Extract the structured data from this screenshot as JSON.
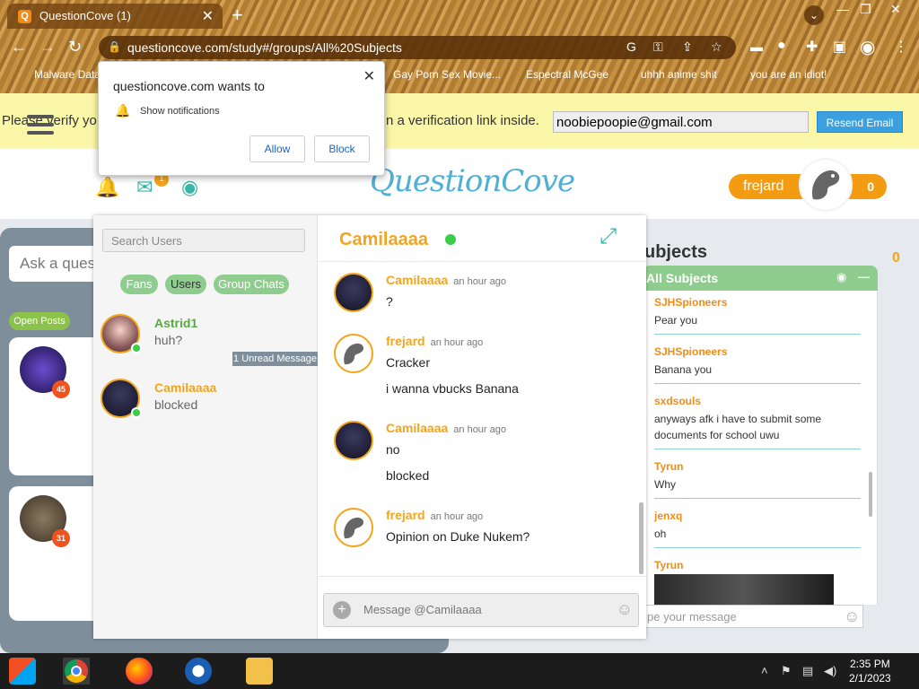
{
  "browser": {
    "tab_title": "QuestionCove (1)",
    "tab_favicon": "Q",
    "url": "questioncove.com/study#/groups/All%20Subjects",
    "bookmarks": [
      "Malware Data",
      "Gay Porn Sex Movie...",
      "Espectral McGee",
      "uhhh anime shit",
      "you are an idiot!"
    ]
  },
  "notification_prompt": {
    "title": "questioncove.com wants to",
    "permission": "Show notifications",
    "allow_label": "Allow",
    "block_label": "Block"
  },
  "verify_bar": {
    "text_start": "Please verify yo",
    "text_end": "n a verification link inside.",
    "email_value": "noobiepoopie@gmail.com",
    "resend_label": "Resend Email"
  },
  "header": {
    "logo_text": "QuestionCove",
    "mail_badge": "1",
    "username": "frejard",
    "score": "0"
  },
  "background": {
    "ask_placeholder": "Ask a ques",
    "open_posts_label": "Open Posts",
    "post_badges": [
      "45",
      "31"
    ],
    "subjects_title": "ubjects",
    "subjects_count": "0",
    "all_subjects_label": "All Subjects",
    "feed": [
      {
        "user": "SJHSpioneers",
        "message": "Pear you"
      },
      {
        "user": "SJHSpioneers",
        "message": "Banana you"
      },
      {
        "user": "sxdsouls",
        "message": "anyways afk i have to submit some documents for school uwu"
      },
      {
        "user": "Tyrun",
        "message": "Why"
      },
      {
        "user": "jenxq",
        "message": "oh"
      },
      {
        "user": "Tyrun",
        "message": ""
      }
    ],
    "feed_input_placeholder": "pe your message"
  },
  "chat": {
    "search_placeholder": "Search Users",
    "filters": [
      "Fans",
      "Users",
      "Group Chats"
    ],
    "conversations": [
      {
        "name": "Astrid1",
        "last_message": "huh?"
      },
      {
        "name": "Camilaaaa",
        "last_message": "blocked"
      }
    ],
    "unread_label": "1 Unread Message",
    "active_name": "Camilaaaa",
    "messages": [
      {
        "user": "Camilaaaa",
        "time": "an hour ago",
        "lines": [
          "?"
        ]
      },
      {
        "user": "frejard",
        "time": "an hour ago",
        "lines": [
          "Cracker",
          "i wanna vbucks Banana"
        ]
      },
      {
        "user": "Camilaaaa",
        "time": "an hour ago",
        "lines": [
          "no",
          "blocked"
        ]
      },
      {
        "user": "frejard",
        "time": "an hour ago",
        "lines": [
          "Opinion on Duke Nukem?"
        ]
      }
    ],
    "input_placeholder": "Message @Camilaaaa"
  },
  "taskbar": {
    "time": "2:35 PM",
    "date": "2/1/2023"
  },
  "colors": {
    "accent_orange": "#f3a51c",
    "accent_green": "#8fcd8f",
    "online_green": "#3ccc4a",
    "verify_bg": "#fbf7a8"
  }
}
